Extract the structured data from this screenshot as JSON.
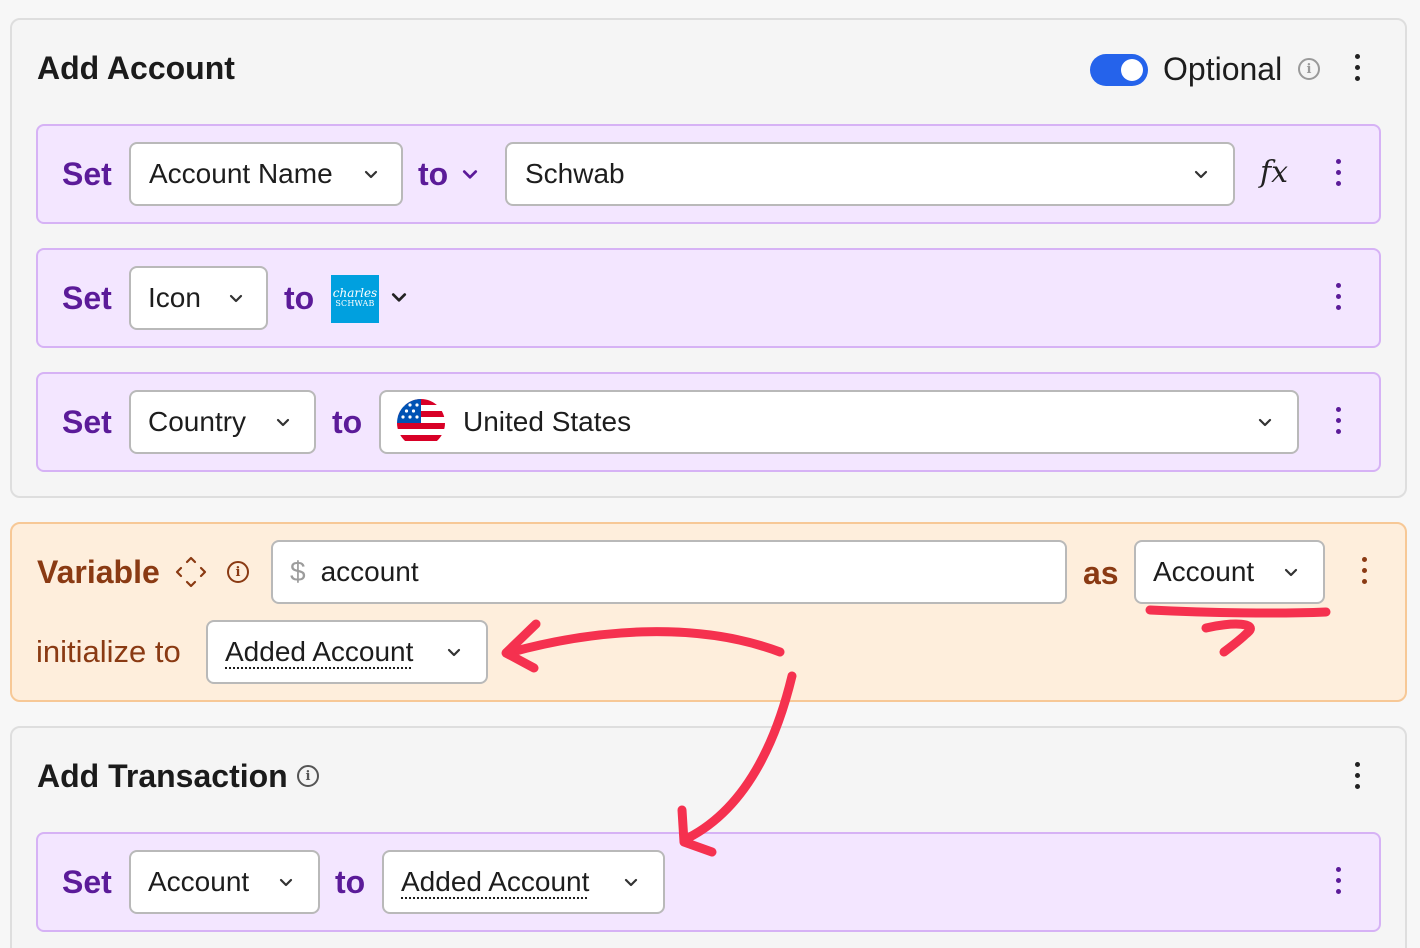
{
  "add_account": {
    "title": "Add Account",
    "optional_label": "Optional",
    "optional_enabled": true,
    "rows": [
      {
        "set_label": "Set",
        "field": "Account Name",
        "to_label": "to",
        "value": "Schwab",
        "formula_icon": "fx"
      },
      {
        "set_label": "Set",
        "field": "Icon",
        "to_label": "to",
        "value_icon": "charles-schwab-logo",
        "logo_text_1": "charles",
        "logo_text_2": "SCHWAB"
      },
      {
        "set_label": "Set",
        "field": "Country",
        "to_label": "to",
        "value": "United States",
        "value_icon": "us-flag-icon"
      }
    ]
  },
  "variable": {
    "label": "Variable",
    "prefix": "$",
    "name": "account",
    "as_label": "as",
    "type": "Account",
    "initialize_label": "initialize to",
    "initialize_value": "Added Account"
  },
  "add_transaction": {
    "title": "Add Transaction",
    "rows": [
      {
        "set_label": "Set",
        "field": "Account",
        "to_label": "to",
        "value": "Added Account"
      }
    ]
  },
  "colors": {
    "purple_text": "#5b1b99",
    "row_bg": "#f3e6ff",
    "row_border": "#d6b2f5",
    "variable_bg": "#feeedc",
    "variable_text": "#8a3a13",
    "toggle_blue": "#2563eb",
    "annotation_red": "#f5314f",
    "schwab_blue": "#00a0df"
  }
}
